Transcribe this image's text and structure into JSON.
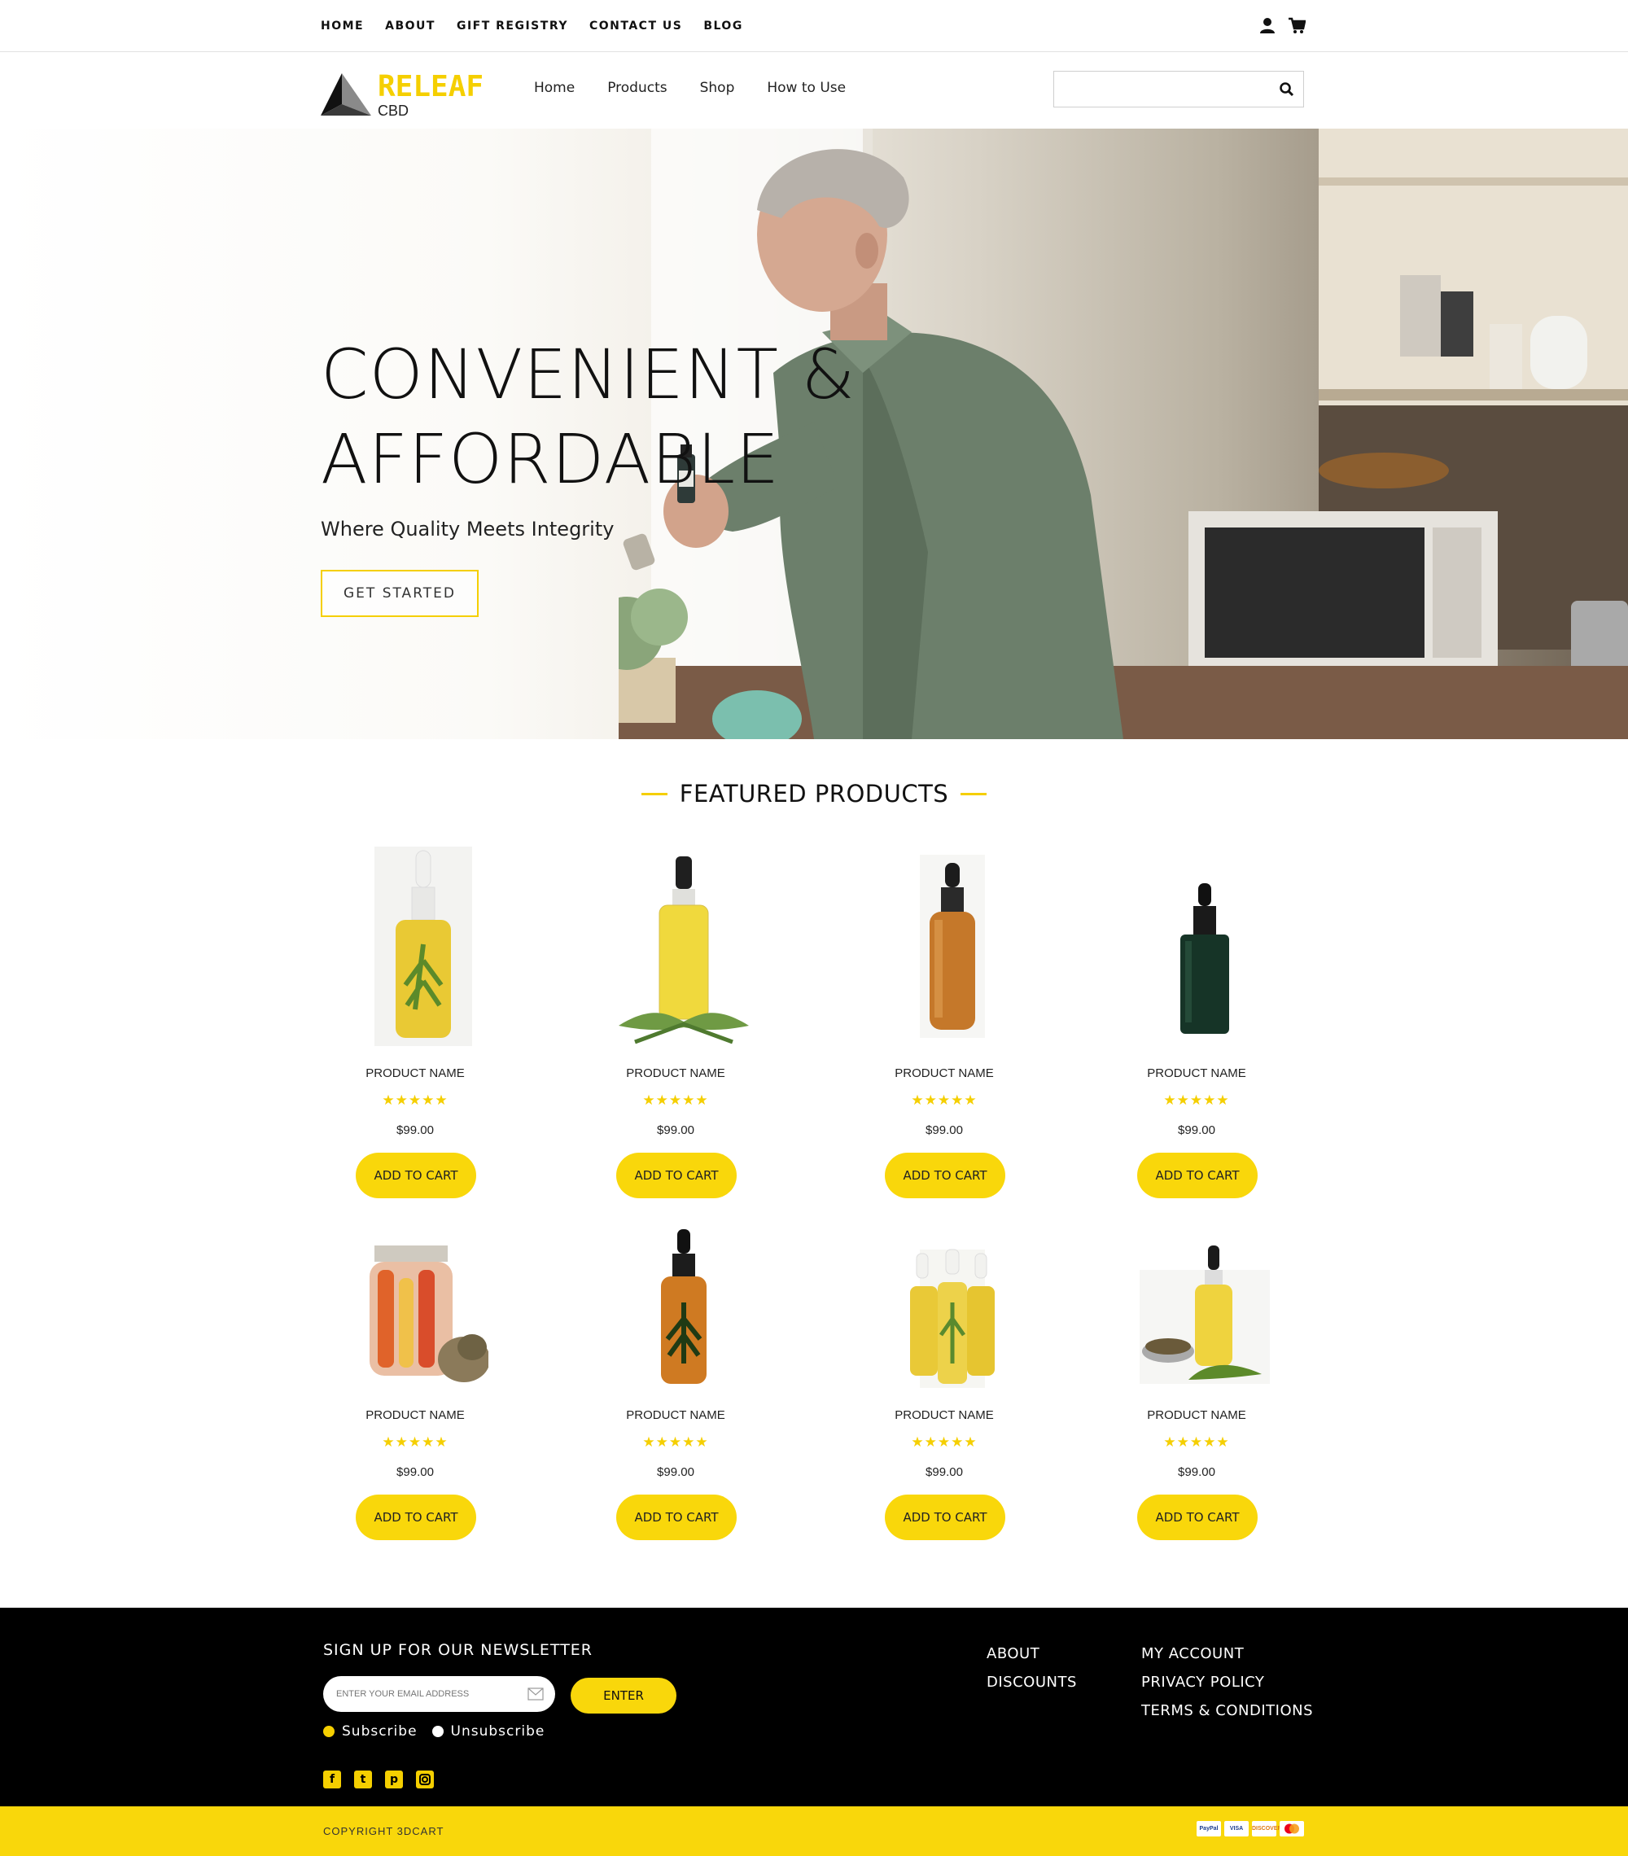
{
  "topbar": {
    "links": [
      "HOME",
      "ABOUT",
      "GIFT REGISTRY",
      "CONTACT US",
      "BLOG"
    ]
  },
  "brand": {
    "name": "RELEAF",
    "sub": "CBD",
    "accent_color": "#f5cf00"
  },
  "mainnav": {
    "links": [
      "Home",
      "Products",
      "Shop",
      "How to Use"
    ]
  },
  "search": {
    "placeholder": ""
  },
  "hero": {
    "title": "CONVENIENT &\nAFFORDABLE",
    "subtitle": "Where Quality Meets Integrity",
    "button_label": "GET STARTED"
  },
  "featured": {
    "heading": "FEATURED PRODUCTS",
    "products": [
      {
        "name": "PRODUCT NAME",
        "price": "$99.00",
        "rating": 5,
        "stars": "★★★★★",
        "button": "ADD TO CART",
        "image": "dropper-bottle-leaf-icon"
      },
      {
        "name": "PRODUCT NAME",
        "price": "$99.00",
        "rating": 5,
        "stars": "★★★★★",
        "button": "ADD TO CART",
        "image": "oil-bottle-hemp-leaves-icon"
      },
      {
        "name": "PRODUCT NAME",
        "price": "$99.00",
        "rating": 5,
        "stars": "★★★★★",
        "button": "ADD TO CART",
        "image": "amber-dropper-bottle-icon"
      },
      {
        "name": "PRODUCT NAME",
        "price": "$99.00",
        "rating": 5,
        "stars": "★★★★★",
        "button": "ADD TO CART",
        "image": "green-dropper-bottle-icon"
      },
      {
        "name": "PRODUCT NAME",
        "price": "$99.00",
        "rating": 5,
        "stars": "★★★★★",
        "button": "ADD TO CART",
        "image": "pickle-jar-icon"
      },
      {
        "name": "PRODUCT NAME",
        "price": "$99.00",
        "rating": 5,
        "stars": "★★★★★",
        "button": "ADD TO CART",
        "image": "amber-bottle-leaf-label-icon"
      },
      {
        "name": "PRODUCT NAME",
        "price": "$99.00",
        "rating": 5,
        "stars": "★★★★★",
        "button": "ADD TO CART",
        "image": "three-oil-bottles-icon"
      },
      {
        "name": "PRODUCT NAME",
        "price": "$99.00",
        "rating": 5,
        "stars": "★★★★★",
        "button": "ADD TO CART",
        "image": "oil-bottle-seeds-bowl-icon"
      }
    ]
  },
  "footer": {
    "newsletter_title": "SIGN UP FOR OUR NEWSLETTER",
    "email_placeholder": "ENTER YOUR EMAIL ADDRESS",
    "enter_label": "ENTER",
    "subscribe_label": "Subscribe",
    "unsubscribe_label": "Unsubscribe",
    "social": [
      "facebook-icon",
      "twitter-icon",
      "pinterest-icon",
      "instagram-icon"
    ],
    "col1": [
      "ABOUT",
      "DISCOUNTS"
    ],
    "col2": [
      "MY ACCOUNT",
      "PRIVACY POLICY",
      "TERMS & CONDITIONS"
    ]
  },
  "copyright": "COPYRIGHT 3DCART",
  "payments": [
    "PayPal",
    "VISA",
    "DISCOVER",
    "MC"
  ]
}
